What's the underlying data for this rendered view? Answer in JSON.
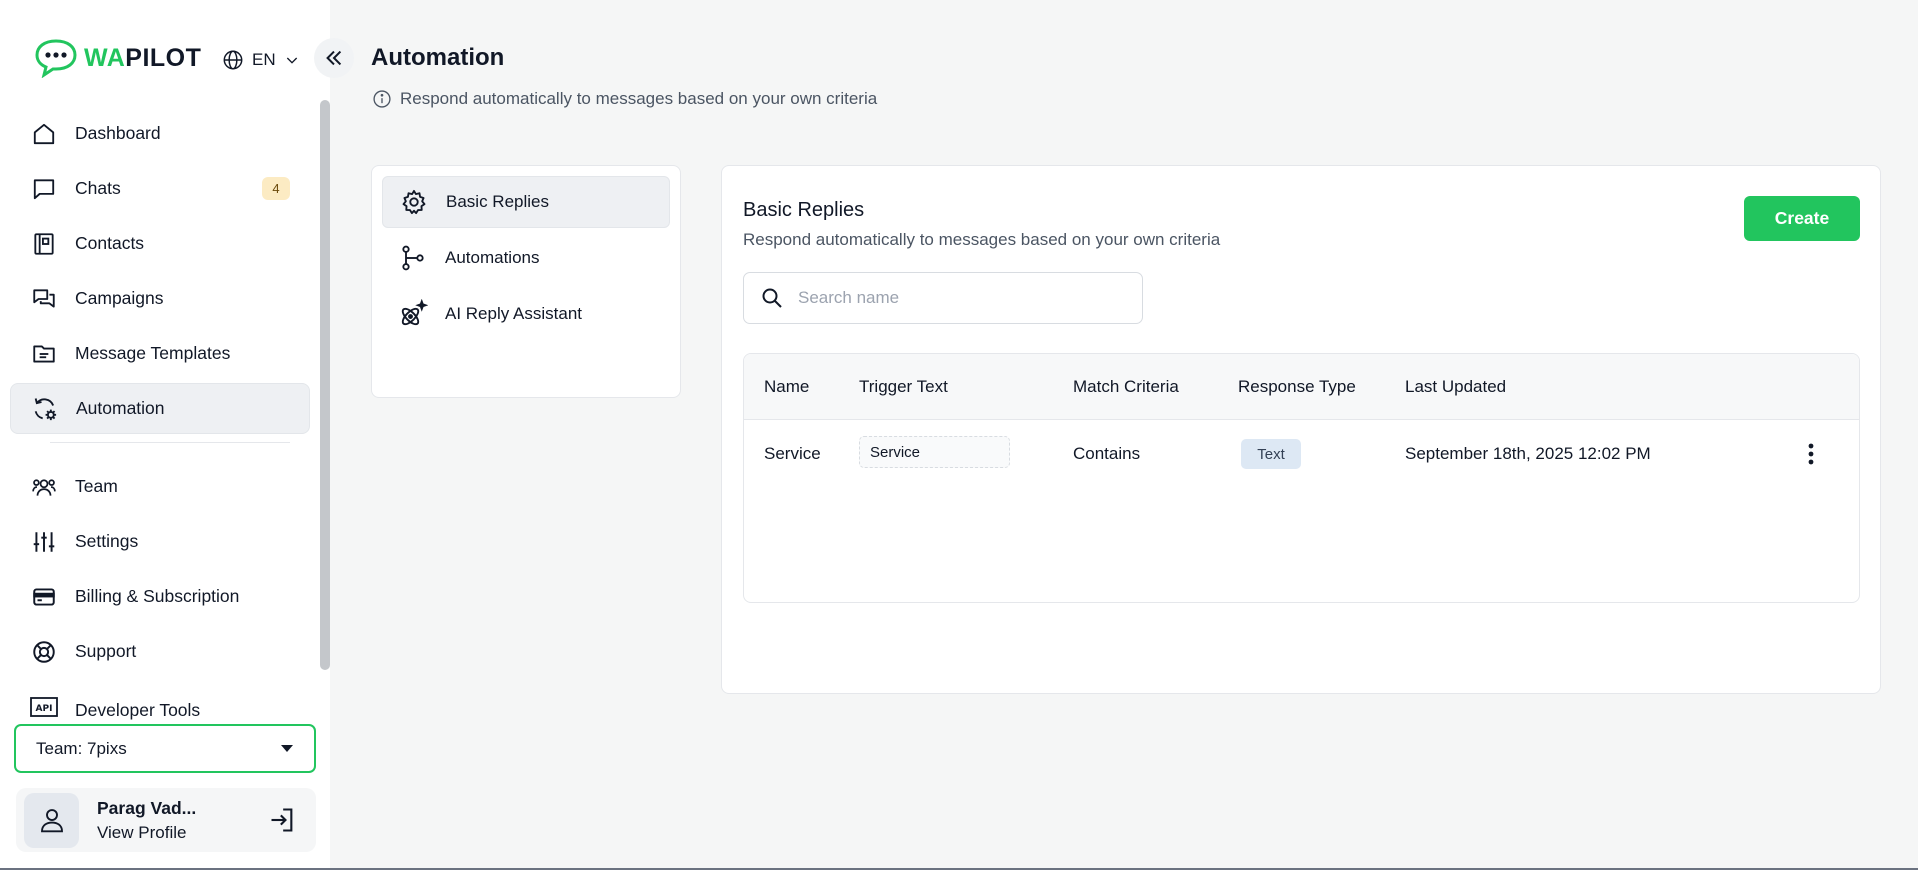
{
  "brand": {
    "part1": "WA",
    "part2": "PILOT"
  },
  "language": {
    "label": "EN"
  },
  "sidebar": {
    "items": [
      {
        "label": "Dashboard",
        "icon": "home-icon"
      },
      {
        "label": "Chats",
        "icon": "chat-icon",
        "badge": "4"
      },
      {
        "label": "Contacts",
        "icon": "contacts-book-icon"
      },
      {
        "label": "Campaigns",
        "icon": "campaigns-icon"
      },
      {
        "label": "Message Templates",
        "icon": "folder-template-icon"
      },
      {
        "label": "Automation",
        "icon": "automation-gear-icon",
        "active": true
      },
      {
        "label": "Team",
        "icon": "team-icon"
      },
      {
        "label": "Settings",
        "icon": "sliders-icon"
      },
      {
        "label": "Billing & Subscription",
        "icon": "credit-card-icon"
      },
      {
        "label": "Support",
        "icon": "lifebuoy-icon"
      },
      {
        "label": "Developer Tools",
        "icon": "api-icon"
      }
    ],
    "team_select": "Team: 7pixs",
    "profile": {
      "name": "Parag Vad...",
      "link": "View Profile"
    }
  },
  "page": {
    "title": "Automation",
    "subtitle": "Respond automatically to messages based on your own criteria"
  },
  "submenu": {
    "items": [
      {
        "label": "Basic Replies",
        "icon": "gear-icon",
        "active": true
      },
      {
        "label": "Automations",
        "icon": "flow-branch-icon"
      },
      {
        "label": "AI Reply Assistant",
        "icon": "ai-sparkle-icon"
      }
    ]
  },
  "panel": {
    "title": "Basic Replies",
    "subtitle": "Respond automatically to messages based on your own criteria",
    "create_label": "Create",
    "search_placeholder": "Search name"
  },
  "table": {
    "columns": [
      "Name",
      "Trigger Text",
      "Match Criteria",
      "Response Type",
      "Last Updated"
    ],
    "rows": [
      {
        "name": "Service",
        "trigger": "Service",
        "match": "Contains",
        "type": "Text",
        "updated": "September 18th, 2025 12:02 PM"
      }
    ]
  },
  "colors": {
    "accent": "#22c55e",
    "badge_bg": "#fcebc3",
    "chip_bg": "#dde8f4"
  }
}
